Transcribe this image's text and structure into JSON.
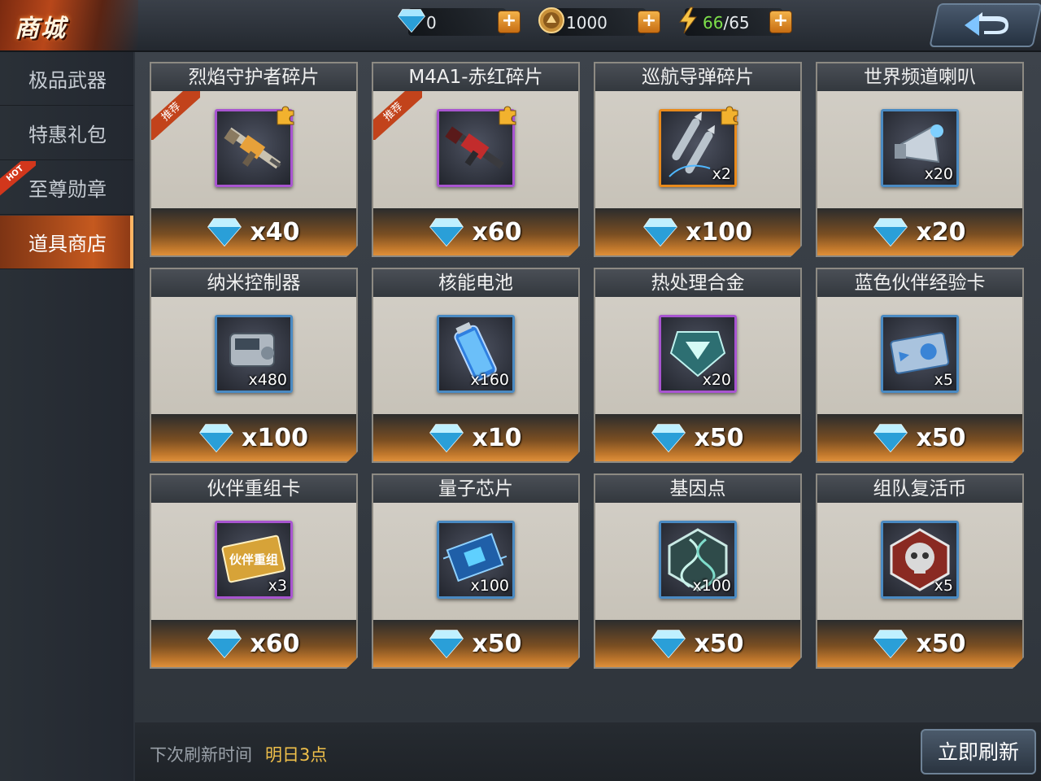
{
  "header": {
    "logo": "商城",
    "gems": {
      "value": "0",
      "icon": "diamond-icon"
    },
    "gold": {
      "value": "1000",
      "icon": "gold-coin-icon"
    },
    "energy": {
      "current": "66",
      "separator": "/",
      "max": "65",
      "icon": "lightning-icon"
    },
    "plus_label": "+"
  },
  "sidebar": {
    "items": [
      {
        "label": "极品武器"
      },
      {
        "label": "特惠礼包"
      },
      {
        "label": "至尊勋章",
        "badge": "HOT"
      },
      {
        "label": "道具商店"
      }
    ]
  },
  "shop": {
    "items": [
      {
        "name": "烈焰守护者碎片",
        "price": "x40",
        "ribbon": "推荐",
        "qty": "",
        "icon": "rifle-icon"
      },
      {
        "name": "M4A1-赤红碎片",
        "price": "x60",
        "ribbon": "推荐",
        "qty": "",
        "icon": "rifle-icon"
      },
      {
        "name": "巡航导弹碎片",
        "price": "x100",
        "ribbon": "",
        "qty": "x2",
        "icon": "missile-icon"
      },
      {
        "name": "世界频道喇叭",
        "price": "x20",
        "ribbon": "",
        "qty": "x20",
        "icon": "megaphone-icon"
      },
      {
        "name": "纳米控制器",
        "price": "x100",
        "ribbon": "",
        "qty": "x480",
        "icon": "controller-icon"
      },
      {
        "name": "核能电池",
        "price": "x10",
        "ribbon": "",
        "qty": "x160",
        "icon": "battery-icon"
      },
      {
        "name": "热处理合金",
        "price": "x50",
        "ribbon": "",
        "qty": "x20",
        "icon": "alloy-icon"
      },
      {
        "name": "蓝色伙伴经验卡",
        "price": "x50",
        "ribbon": "",
        "qty": "x5",
        "icon": "exp-card-icon"
      },
      {
        "name": "伙伴重组卡",
        "price": "x60",
        "ribbon": "",
        "qty": "x3",
        "icon": "reorg-card-icon",
        "card_text": "伙伴重组"
      },
      {
        "name": "量子芯片",
        "price": "x50",
        "ribbon": "",
        "qty": "x100",
        "icon": "chip-icon"
      },
      {
        "name": "基因点",
        "price": "x50",
        "ribbon": "",
        "qty": "x100",
        "icon": "dna-icon"
      },
      {
        "name": "组队复活币",
        "price": "x50",
        "ribbon": "",
        "qty": "x5",
        "icon": "skull-icon"
      }
    ]
  },
  "footer": {
    "refresh_label": "下次刷新时间",
    "refresh_time": "明日3点",
    "refresh_button": "立即刷新"
  },
  "colors": {
    "accent": "#c5591f",
    "price_gradient_end": "#e0903a",
    "gem": "#6fd3ff"
  }
}
